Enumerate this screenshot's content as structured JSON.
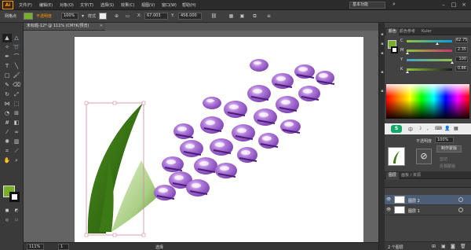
{
  "app": {
    "logo": "Ai"
  },
  "menu": [
    "文件(F)",
    "编辑(E)",
    "对象(O)",
    "文字(T)",
    "选择(S)",
    "效果(C)",
    "视图(V)",
    "窗口(W)",
    "帮助(H)"
  ],
  "workspace": "基本功能",
  "controlbar": {
    "selection_label": "网格点",
    "fill_color": "#7aae25",
    "stroke_label": "不透明度",
    "opacity_value": "100%",
    "style_label": "样式",
    "x_value": "67.003",
    "y_value": "456.000",
    "x_label": "X:",
    "y_label": "Y:"
  },
  "document": {
    "tab_title": "未标题-12* @ 111% (CMYK/预览)"
  },
  "statusbar": {
    "zoom": "111%",
    "page": "1",
    "tool": "选择"
  },
  "colors": {
    "fill": "#7aae25",
    "stroke": "#ffffff",
    "flower": "#8a4fc2",
    "leaf_dark": "#2f6b12",
    "leaf_light": "#c8e2a8"
  },
  "color_panel": {
    "tabs": [
      "颜色",
      "颜色参考",
      "Kuler"
    ],
    "sliders": [
      {
        "label": "C",
        "value": "62.75",
        "level": 0.63,
        "track": "#00c8ff"
      },
      {
        "label": "M",
        "value": "2.35",
        "level": 0.02,
        "track": "#ff3aa0"
      },
      {
        "label": "Y",
        "value": "100",
        "level": 1.0,
        "track": "#ffe000"
      },
      {
        "label": "K",
        "value": "0.86",
        "level": 0.01,
        "track": "#888888"
      }
    ]
  },
  "appearance_panel": {
    "opacity_label": "不透明度",
    "opacity_value": "100%",
    "make_mask": "制作蒙版",
    "clip": "剪切",
    "invert_mask": "反相蒙版"
  },
  "layers_panel": {
    "tabs": [
      "图层",
      "画板 / 资源"
    ],
    "layers": [
      {
        "name": "图层 2",
        "selected": true
      },
      {
        "name": "图层 1",
        "selected": false
      }
    ],
    "footer": "2 个图层"
  }
}
